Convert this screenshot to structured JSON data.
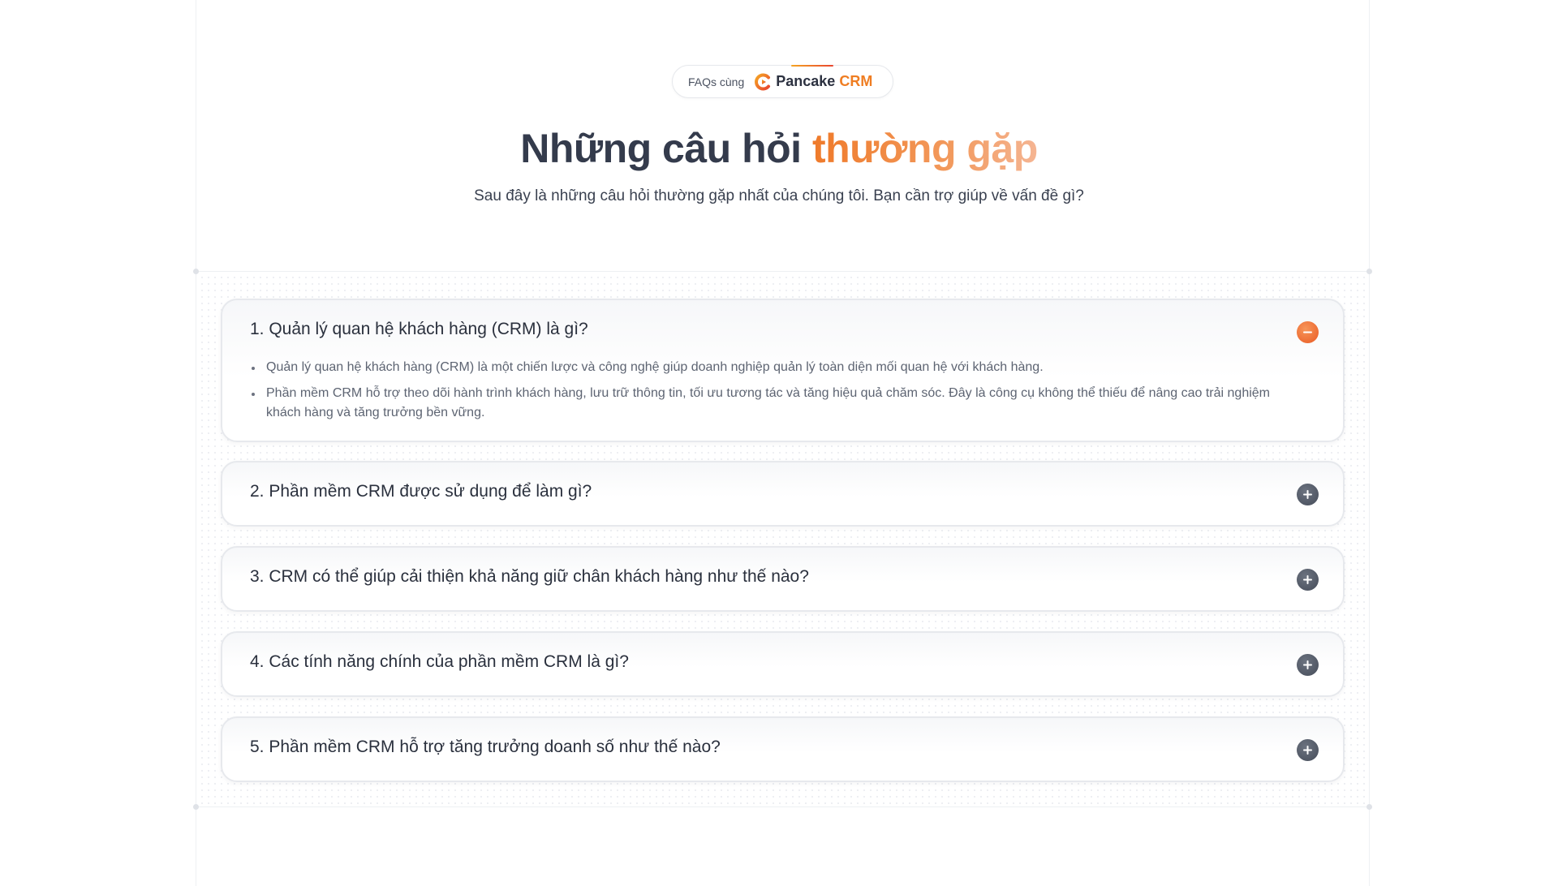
{
  "badge": {
    "prefix": "FAQs cùng",
    "brand_name": "Pancake",
    "brand_suffix": "CRM",
    "logo_icon": "pancake-logo-icon",
    "accent_colors": [
      "#f5a524",
      "#e8452f"
    ]
  },
  "header": {
    "title_main": "Những câu hỏi ",
    "title_accent": "thường gặp",
    "subtitle": "Sau đây là những câu hỏi thường gặp nhất của chúng tôi. Bạn cần trợ giúp về vấn đề gì?"
  },
  "faqs": [
    {
      "question": "1. Quản lý quan hệ khách hàng (CRM) là gì?",
      "expanded": true,
      "toggle_icon": "minus-icon",
      "answer": [
        "Quản lý quan hệ khách hàng (CRM) là một chiến lược và công nghệ giúp doanh nghiệp quản lý toàn diện mối quan hệ với khách hàng.",
        "Phần mềm CRM hỗ trợ theo dõi hành trình khách hàng, lưu trữ thông tin, tối ưu tương tác và tăng hiệu quả chăm sóc. Đây là công cụ không thể thiếu để nâng cao trải nghiệm khách hàng và tăng trưởng bền vững."
      ]
    },
    {
      "question": "2. Phần mềm CRM được sử dụng để làm gì?",
      "expanded": false,
      "toggle_icon": "plus-icon"
    },
    {
      "question": "3. CRM có thể giúp cải thiện khả năng giữ chân khách hàng như thế nào?",
      "expanded": false,
      "toggle_icon": "plus-icon"
    },
    {
      "question": "4. Các tính năng chính của phần mềm CRM là gì?",
      "expanded": false,
      "toggle_icon": "plus-icon"
    },
    {
      "question": "5. Phần mềm CRM hỗ trợ tăng trưởng doanh số như thế nào?",
      "expanded": false,
      "toggle_icon": "plus-icon"
    }
  ],
  "colors": {
    "accent_orange": "#ef7d22",
    "heading_dark": "#343b4c",
    "open_toggle": "#e95a23",
    "closed_toggle": "#454c59"
  }
}
